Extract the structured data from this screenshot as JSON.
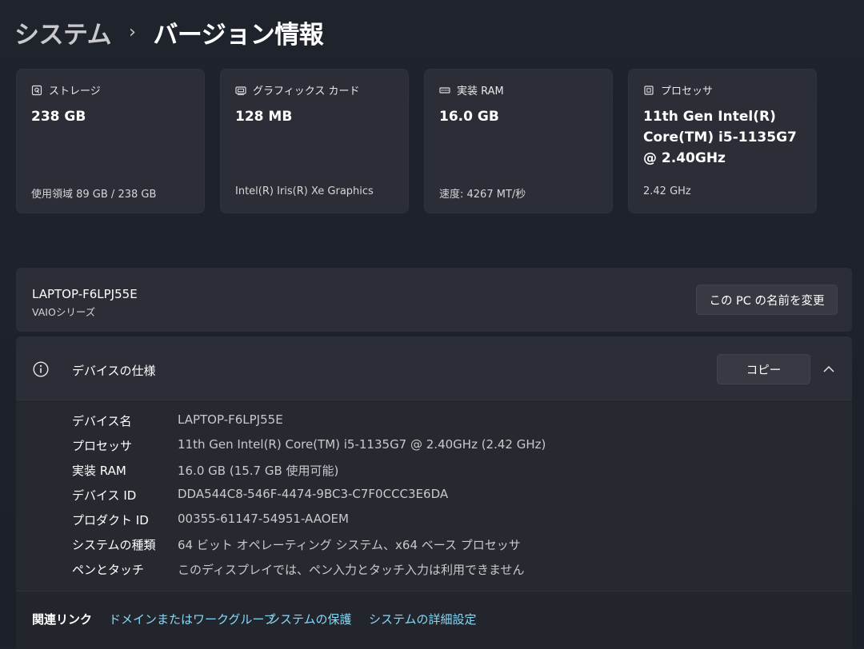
{
  "breadcrumb": {
    "parent": "システム",
    "separator": "›",
    "current": "バージョン情報"
  },
  "cards": [
    {
      "icon": "storage-icon",
      "title": "ストレージ",
      "value": "238 GB",
      "sub": "使用領域 89 GB / 238 GB"
    },
    {
      "icon": "graphics-card-icon",
      "title": "グラフィックス カード",
      "value": "128 MB",
      "sub": "Intel(R) Iris(R) Xe Graphics"
    },
    {
      "icon": "ram-icon",
      "title": "実装 RAM",
      "value": "16.0 GB",
      "sub": "速度: 4267 MT/秒"
    },
    {
      "icon": "processor-icon",
      "title": "プロセッサ",
      "value": "11th Gen Intel(R) Core(TM) i5-1135G7 @ 2.40GHz",
      "sub": "2.42 GHz"
    }
  ],
  "pc": {
    "name": "LAPTOP-F6LPJ55E",
    "model": "VAIOシリーズ",
    "rename_label": "この PC の名前を変更"
  },
  "specs": {
    "title": "デバイスの仕様",
    "copy_label": "コピー",
    "rows": [
      {
        "key": "デバイス名",
        "value": "LAPTOP-F6LPJ55E"
      },
      {
        "key": "プロセッサ",
        "value": "11th Gen Intel(R) Core(TM) i5-1135G7 @ 2.40GHz (2.42 GHz)"
      },
      {
        "key": "実装 RAM",
        "value": "16.0 GB (15.7 GB 使用可能)"
      },
      {
        "key": "デバイス ID",
        "value": "DDA544C8-546F-4474-9BC3-C7F0CCC3E6DA"
      },
      {
        "key": "プロダクト ID",
        "value": "00355-61147-54951-AAOEM"
      },
      {
        "key": "システムの種類",
        "value": "64 ビット オペレーティング システム、x64 ベース プロセッサ"
      },
      {
        "key": "ペンとタッチ",
        "value": "このディスプレイでは、ペン入力とタッチ入力は利用できません"
      }
    ]
  },
  "related": {
    "label": "関連リンク",
    "links": [
      "ドメインまたはワークグループ",
      "システムの保護",
      "システムの詳細設定"
    ]
  },
  "colors": {
    "link": "#8ad8f7",
    "card_bg": "#2b2e36",
    "page_bg": "#1d2129"
  }
}
